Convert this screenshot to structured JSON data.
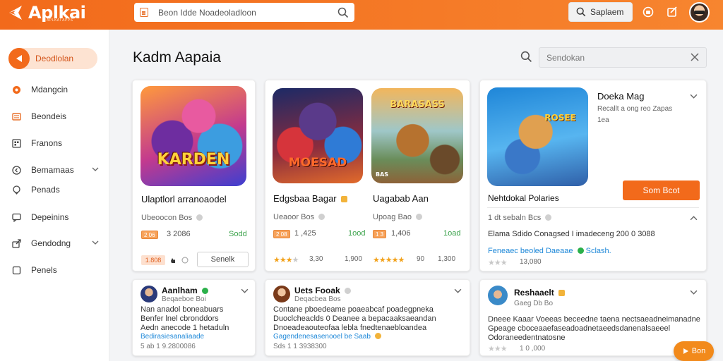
{
  "header": {
    "logo_text": "Aplkai",
    "logo_sub": "APLKAI APPS",
    "search_text": "Beon Idde Noadeoladloon",
    "search_button": "Saplaem"
  },
  "sidebar": {
    "active": "Deodlolan",
    "items": [
      "Mdangcin",
      "Beondeis",
      "Franons",
      "Bemamaas",
      "Penads",
      "Depeinins",
      "Gendodng",
      "Penels"
    ]
  },
  "main": {
    "title": "Kadm Aapaia",
    "search_placeholder": "Sendokan"
  },
  "cards": {
    "c1": {
      "art": "KARDEN",
      "title": "Ulaptlorl arranoaodel",
      "meta": "Ubeoocon Bos",
      "tag": "2 06",
      "num": "3 2086",
      "green": "Sodd",
      "price": "1.808",
      "button": "Senelk"
    },
    "c2": {
      "a_art": "MOESAD",
      "a_title": "Edgsbaa Bagar",
      "a_meta": "Ueaoor Bos",
      "a_tag": "2 08",
      "a_num": "1 ,425",
      "a_green": "1ood",
      "a_rating": "3,30",
      "a_price": "1,900",
      "b_art": "BARASASS",
      "b_art_corner": "BAS",
      "b_title": "Uagabab Aan",
      "b_meta": "Upoag Bao",
      "b_tag": "1 3",
      "b_num": "1,406",
      "b_green": "1oad",
      "b_rating": "90",
      "b_price": "1,300"
    },
    "c3": {
      "art": "ROSEE",
      "title": "Doeka Mag",
      "sub": "Recallt a ong reo Zapas",
      "sub2": "1ea",
      "button": "Som Bcot",
      "name": "Nehtdokal Polaries",
      "meta": "1 dt sebaln Bcs",
      "desc": "Elama Sdido Conagsed I imadeceng 200 0 3088",
      "link": "Feneaec beoled Daeaae",
      "link2": "Sclash.",
      "rating": "13,080"
    }
  },
  "reviews": [
    {
      "name": "Aanlham",
      "sub": "Beqaeboe Boi",
      "body": [
        "Nan anadol boneabuars",
        "Benfer lnel cbronddors",
        "Aedn anecode 1 hetaduln"
      ],
      "link": "Bedirasiesanaliaade",
      "foot": "5 ab 1 9.2800086"
    },
    {
      "name": "Uets Fooak",
      "sub": "Deqacbea Bos",
      "body": [
        "Contane pboedeame poaeabcaf poadegpneka",
        "Duoclcheaclds 0 Deanee a bepacaaksaeandan",
        "Dnoeadeaouteofaa lebla fnedtenaebloandea"
      ],
      "link": "Gagendenesasenooel be Saab",
      "foot": "Sds 1 1 3938300"
    },
    {
      "name": "Reshaaelt",
      "sub": "Gaeg Db Bo",
      "body": [
        "Dneee Kaaar Voeeas beceedne taena nectsaeadneimanadne",
        "Gpeage cboceaaefaseadoadnetaeedsdanenalsaeeel",
        "Odoraneedentnatosne"
      ],
      "link": "",
      "foot": "1 0 ,000"
    }
  ],
  "fab": "Bon"
}
